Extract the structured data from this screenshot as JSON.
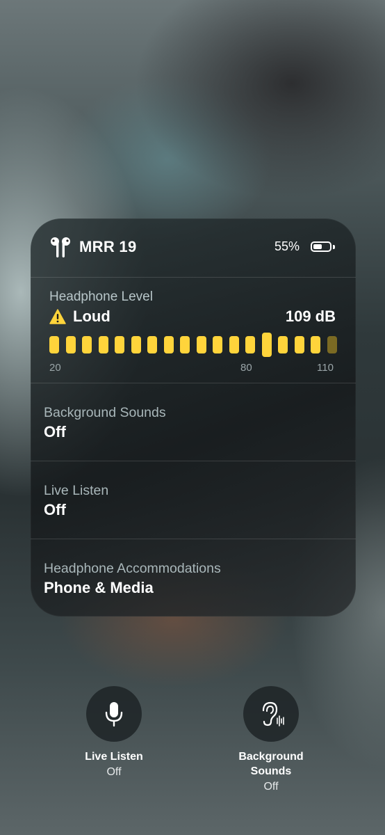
{
  "device": {
    "name": "MRR 19",
    "battery_percent_label": "55%",
    "battery_level": 0.55,
    "icon": "airpods-icon"
  },
  "headphone_level": {
    "title": "Headphone Level",
    "status": "Loud",
    "status_icon": "warning-icon",
    "value_label": "109 dB",
    "scale_labels": {
      "min": "20",
      "mid": "80",
      "max": "110"
    },
    "segments_total": 18,
    "segments_active": 17,
    "peak_segment": 13,
    "accent_color": "#ffd43b"
  },
  "rows": [
    {
      "label": "Background Sounds",
      "value": "Off"
    },
    {
      "label": "Live Listen",
      "value": "Off"
    },
    {
      "label": "Headphone Accommodations",
      "value": "Phone & Media"
    }
  ],
  "controls": {
    "live_listen": {
      "label": "Live Listen",
      "status": "Off",
      "icon": "microphone-icon"
    },
    "background_sounds": {
      "label_line1": "Background",
      "label_line2": "Sounds",
      "status": "Off",
      "icon": "ear-sound-icon"
    }
  }
}
